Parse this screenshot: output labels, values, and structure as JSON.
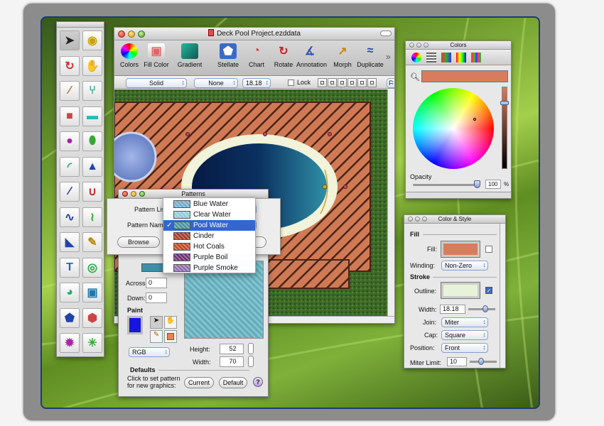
{
  "document": {
    "title": "Deck Pool Project.ezddata",
    "toolbar": [
      {
        "label": "Colors",
        "icon": "color-wheel-icon"
      },
      {
        "label": "Fill Color",
        "icon": "fill-color-icon"
      },
      {
        "label": "Gradient",
        "icon": "gradient-icon"
      },
      {
        "label": "Stellate",
        "icon": "stellate-icon"
      },
      {
        "label": "Chart",
        "icon": "chart-icon"
      },
      {
        "label": "Rotate",
        "icon": "rotate-icon"
      },
      {
        "label": "Annotation",
        "icon": "annotation-icon"
      },
      {
        "label": "Morph",
        "icon": "morph-icon"
      },
      {
        "label": "Duplicate",
        "icon": "duplicate-icon"
      }
    ],
    "overflow": "»",
    "line_style": "Solid",
    "arrow_style": "None",
    "line_width": "18.18",
    "lock_label": "Lock",
    "extra_button": "F"
  },
  "patterns": {
    "title": "Patterns",
    "pattern_list_label": "Pattern List",
    "pattern_name_label": "Pattern Name",
    "browse_button": "Browse",
    "menu": [
      {
        "name": "Blue Water",
        "color": "#6fa9c9",
        "checked": false,
        "selected": false
      },
      {
        "name": "Clear Water",
        "color": "#8ccbd6",
        "checked": false,
        "selected": false
      },
      {
        "name": "Pool Water",
        "color": "#3f8fa8",
        "checked": true,
        "selected": true
      },
      {
        "name": "Cinder",
        "color": "#a3331f",
        "checked": false,
        "selected": false
      },
      {
        "name": "Hot Coals",
        "color": "#c2411a",
        "checked": false,
        "selected": false
      },
      {
        "name": "Purple Boil",
        "color": "#6b2a6c",
        "checked": false,
        "selected": false
      },
      {
        "name": "Purple Smoke",
        "color": "#8a6aa8",
        "checked": false,
        "selected": false
      }
    ],
    "checkmark": "✓",
    "across_label": "Across:",
    "across_value": "0",
    "down_label": "Down:",
    "down_value": "0",
    "paint_label": "Paint",
    "paint_color": "#1616e0",
    "color_model": "RGB",
    "height_label": "Height:",
    "height_value": "52",
    "width_label": "Width:",
    "width_value": "70",
    "defaults_label": "Defaults",
    "defaults_text": "Click to set pattern for new graphics:",
    "current_button": "Current",
    "default_button": "Default",
    "help_button": "?"
  },
  "colors_panel": {
    "title": "Colors",
    "current_color": "#d77c5c",
    "opacity_label": "Opacity",
    "opacity_value": "100",
    "opacity_unit": "%"
  },
  "color_style": {
    "title": "Color & Style",
    "fill_section": "Fill",
    "fill_label": "Fill:",
    "fill_color": "#d77c5c",
    "winding_label": "Winding:",
    "winding_value": "Non-Zero",
    "stroke_section": "Stroke",
    "outline_label": "Outline:",
    "outline_color": "#e6f3d8",
    "width_label": "Width:",
    "width_value": "18.18",
    "join_label": "Join:",
    "join_value": "Miter",
    "cap_label": "Cap:",
    "cap_value": "Square",
    "position_label": "Position:",
    "position_value": "Front",
    "miter_label": "Miter Limit:",
    "miter_value": "10"
  },
  "tools": [
    "arrow-select-icon",
    "tape-measure-icon",
    "rotate-tool-icon",
    "hand-icon",
    "knife-icon",
    "tweezers-icon",
    "rectangle-icon",
    "rounded-rect-icon",
    "circle-icon",
    "ellipse-icon",
    "arc-icon",
    "triangle-icon",
    "line-icon",
    "bezier-icon",
    "freeform-icon",
    "spiral-path-icon",
    "quarter-icon",
    "pencil-icon",
    "text-icon",
    "spiral-icon",
    "paint-bucket-icon",
    "paint-can-icon",
    "pentagon-icon",
    "hexagon-icon",
    "star-icon",
    "starburst-icon"
  ]
}
